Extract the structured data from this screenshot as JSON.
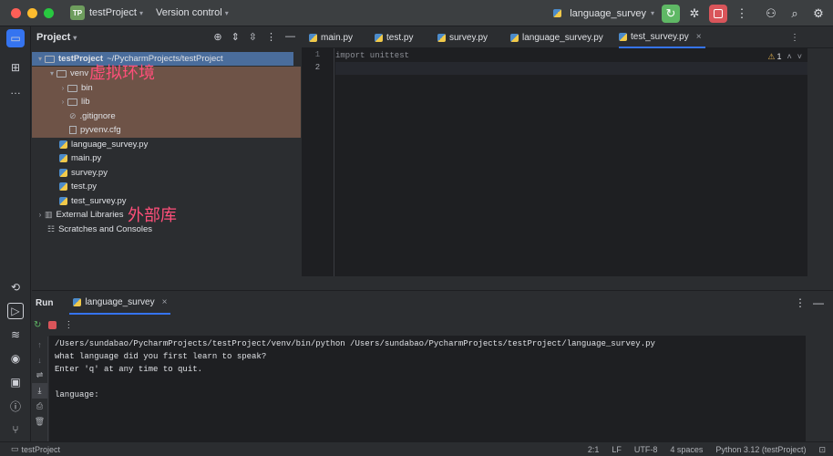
{
  "titlebar": {
    "project_badge": "TP",
    "project_name": "testProject",
    "version_control": "Version control",
    "run_config": "language_survey"
  },
  "project_panel": {
    "title": "Project",
    "tree": [
      {
        "label": "testProject",
        "suffix": "~/PycharmProjects/testProject",
        "icon": "folder-icon",
        "arrow": "▾"
      },
      {
        "label": "venv",
        "icon": "folder-icon",
        "arrow": "▾"
      },
      {
        "label": "bin",
        "icon": "folder-icon",
        "arrow": "›"
      },
      {
        "label": "lib",
        "icon": "folder-icon",
        "arrow": "›"
      },
      {
        "label": ".gitignore",
        "icon": "ignore-icon",
        "arrow": ""
      },
      {
        "label": "pyvenv.cfg",
        "icon": "config-file-icon",
        "arrow": ""
      },
      {
        "label": "language_survey.py",
        "icon": "python-file-icon",
        "arrow": ""
      },
      {
        "label": "main.py",
        "icon": "python-file-icon",
        "arrow": ""
      },
      {
        "label": "survey.py",
        "icon": "python-file-icon",
        "arrow": ""
      },
      {
        "label": "test.py",
        "icon": "python-file-icon",
        "arrow": ""
      },
      {
        "label": "test_survey.py",
        "icon": "python-file-icon",
        "arrow": ""
      },
      {
        "label": "External Libraries",
        "icon": "library-icon",
        "arrow": "›"
      },
      {
        "label": "Scratches and Consoles",
        "icon": "scratches-icon",
        "arrow": ""
      }
    ],
    "annotation_venv": "虚拟环境",
    "annotation_libs": "外部库"
  },
  "editor": {
    "tabs": [
      "main.py",
      "test.py",
      "survey.py",
      "language_survey.py",
      "test_survey.py"
    ],
    "active_tab": "test_survey.py",
    "line_numbers": [
      "1",
      "2"
    ],
    "lines": [
      "import unittest",
      ""
    ],
    "warning_count": "1"
  },
  "run_panel": {
    "title": "Run",
    "tab_label": "language_survey",
    "console_lines": [
      "/Users/sundabao/PycharmProjects/testProject/venv/bin/python /Users/sundabao/PycharmProjects/testProject/language_survey.py",
      "what language did you first learn to speak?",
      "Enter 'q' at any time to quit.",
      "",
      "language:"
    ]
  },
  "statusbar": {
    "breadcrumb": "testProject",
    "position": "2:1",
    "line_ending": "LF",
    "encoding": "UTF-8",
    "indent": "4 spaces",
    "interpreter": "Python 3.12 (testProject)"
  },
  "colors": {
    "accent": "#3574f0",
    "annotation": "#ff4f7a",
    "venv_highlight": "#7a5a4b"
  }
}
